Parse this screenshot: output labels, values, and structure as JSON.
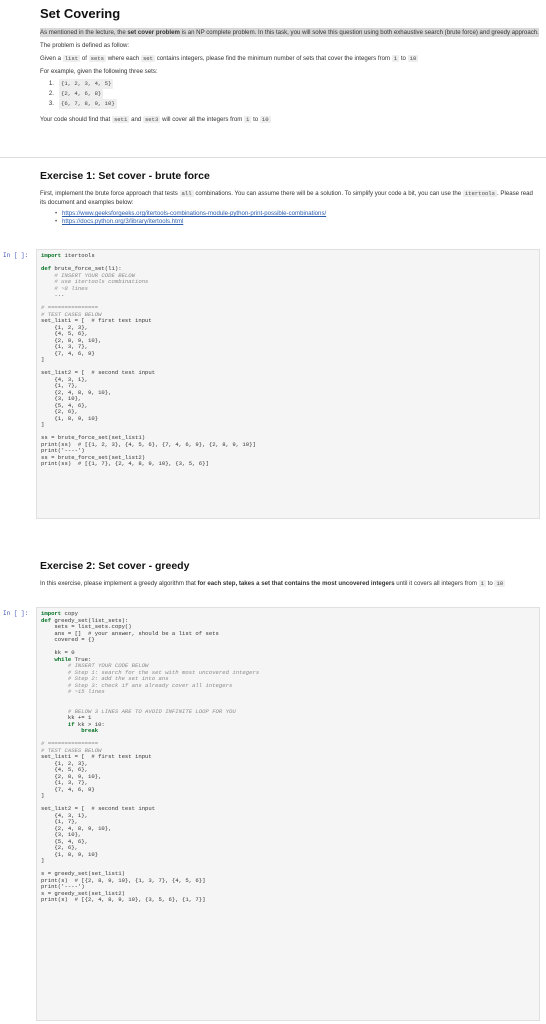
{
  "title": "Set Covering",
  "intro": {
    "p1_pre": "As mentioned in the lecture, the ",
    "p1_bold": "set cover problem",
    "p1_post": " is an NP complete problem. In this task, you will solve this question using both exhaustive search (brute force) and greedy approach.",
    "p2": "The problem is defined as follow:",
    "p3_a": "Given a ",
    "p3_code1": "list",
    "p3_b": " of ",
    "p3_code2": "sets",
    "p3_c": " where each ",
    "p3_code3": "set",
    "p3_d": " contains integers, please find the minimum number of sets that cover the integers from ",
    "p3_code4": "1",
    "p3_e": " to ",
    "p3_code5": "10",
    "p4": "For example, given the following three sets:",
    "list": [
      {
        "num": "1.",
        "code": "{1, 2, 3, 4, 5}"
      },
      {
        "num": "2.",
        "code": "{2, 4, 6, 8}"
      },
      {
        "num": "3.",
        "code": "{6, 7, 8, 9, 10}"
      }
    ],
    "p5_a": "Your code should find that ",
    "p5_code1": "set1",
    "p5_b": " and ",
    "p5_code2": "set3",
    "p5_c": " will cover all the integers from ",
    "p5_code3": "1",
    "p5_d": " to ",
    "p5_code4": "10"
  },
  "ex1": {
    "heading": "Exercise 1: Set cover - brute force",
    "p_a": "First, implement the brute force approach that tests ",
    "p_code1": "all",
    "p_b": " combinations. You can assume there will be a solution. To simplify your code a bit, you can use the ",
    "p_code2": "itertools",
    "p_c": ". Please read its document and examples below:",
    "links": [
      "https://www.geeksforgeeks.org/itertools-combinations-module-python-print-possible-combinations/",
      "https://docs.python.org/3/library/itertools.html"
    ],
    "prompt": "In [ ]:",
    "code": [
      [
        "kw",
        "import",
        " itertools"
      ],
      [
        "",
        "",
        ""
      ],
      [
        "kw",
        "def",
        " brute_force_set(l1):"
      ],
      [
        "cm",
        "",
        "    # INSERT YOUR CODE BELOW"
      ],
      [
        "cm",
        "",
        "    # use itertools combinations"
      ],
      [
        "cm",
        "",
        "    # ~8 lines"
      ],
      [
        "",
        "",
        "    ..."
      ],
      [
        "",
        "",
        ""
      ],
      [
        "cm",
        "",
        "# ==============="
      ],
      [
        "cm",
        "",
        "# TEST CASES BELOW"
      ],
      [
        "",
        "",
        "set_list1 = [  # first test input"
      ],
      [
        "",
        "",
        "    {1, 2, 3},"
      ],
      [
        "",
        "",
        "    {4, 5, 6},"
      ],
      [
        "",
        "",
        "    {2, 8, 9, 10},"
      ],
      [
        "",
        "",
        "    {1, 3, 7},"
      ],
      [
        "",
        "",
        "    {7, 4, 6, 9}"
      ],
      [
        "",
        "",
        "]"
      ],
      [
        "",
        "",
        ""
      ],
      [
        "",
        "",
        "set_list2 = [  # second test input"
      ],
      [
        "",
        "",
        "    {4, 3, 1},"
      ],
      [
        "",
        "",
        "    {1, 7},"
      ],
      [
        "",
        "",
        "    {2, 4, 8, 9, 10},"
      ],
      [
        "",
        "",
        "    {3, 10},"
      ],
      [
        "",
        "",
        "    {5, 4, 6},"
      ],
      [
        "",
        "",
        "    {2, 6},"
      ],
      [
        "",
        "",
        "    {1, 8, 9, 10}"
      ],
      [
        "",
        "",
        "]"
      ],
      [
        "",
        "",
        ""
      ],
      [
        "",
        "",
        "ss = brute_force_set(set_list1)"
      ],
      [
        "",
        "",
        "print(ss)  # [{1, 2, 3}, {4, 5, 6}, {7, 4, 6, 9}, {2, 8, 9, 10}]"
      ],
      [
        "",
        "",
        "print('----')"
      ],
      [
        "",
        "",
        "ss = brute_force_set(set_list2)"
      ],
      [
        "",
        "",
        "print(ss)  # [{1, 7}, {2, 4, 8, 9, 10}, {3, 5, 6}]"
      ]
    ]
  },
  "ex2": {
    "heading": "Exercise 2: Set cover - greedy",
    "p_a": "In this exercise, please implement a greedy algorithm that ",
    "p_bold": "for each step, takes a set that contains the most uncovered integers",
    "p_b": " until it covers all integers from ",
    "p_code1": "1",
    "p_c": " to ",
    "p_code2": "10",
    "prompt": "In [ ]:",
    "code": [
      [
        "kw",
        "import",
        " copy"
      ],
      [
        "kw",
        "def",
        " greedy_set(list_sets):"
      ],
      [
        "",
        "",
        "    sets = list_sets.copy()"
      ],
      [
        "",
        "",
        "    ans = []  # your answer, should be a list of sets"
      ],
      [
        "",
        "",
        "    covered = {}"
      ],
      [
        "",
        "",
        ""
      ],
      [
        "",
        "",
        "    kk = 0"
      ],
      [
        "kw",
        "    while",
        " True:"
      ],
      [
        "cm",
        "",
        "        # INSERT YOUR CODE BELOW"
      ],
      [
        "cm",
        "",
        "        # Step 1: search for the set with most uncovered integers"
      ],
      [
        "cm",
        "",
        "        # Step 2: add the set into ans"
      ],
      [
        "cm",
        "",
        "        # Step 3: check if ans already cover all integers"
      ],
      [
        "cm",
        "",
        "        # ~15 lines"
      ],
      [
        "",
        "",
        ""
      ],
      [
        "",
        "",
        ""
      ],
      [
        "cm",
        "",
        "        # BELOW 3 LINES ARE TO AVOID INFINITE LOOP FOR YOU"
      ],
      [
        "",
        "",
        "        kk += 1"
      ],
      [
        "kw",
        "        if",
        " kk > 10:"
      ],
      [
        "kw",
        "            break",
        ""
      ],
      [
        "",
        "",
        ""
      ],
      [
        "cm",
        "",
        "# ==============="
      ],
      [
        "cm",
        "",
        "# TEST CASES BELOW"
      ],
      [
        "",
        "",
        "set_list1 = [  # first test input"
      ],
      [
        "",
        "",
        "    {1, 2, 3},"
      ],
      [
        "",
        "",
        "    {4, 5, 6},"
      ],
      [
        "",
        "",
        "    {2, 8, 9, 10},"
      ],
      [
        "",
        "",
        "    {1, 3, 7},"
      ],
      [
        "",
        "",
        "    {7, 4, 6, 9}"
      ],
      [
        "",
        "",
        "]"
      ],
      [
        "",
        "",
        ""
      ],
      [
        "",
        "",
        "set_list2 = [  # second test input"
      ],
      [
        "",
        "",
        "    {4, 3, 1},"
      ],
      [
        "",
        "",
        "    {1, 7},"
      ],
      [
        "",
        "",
        "    {2, 4, 8, 9, 10},"
      ],
      [
        "",
        "",
        "    {3, 10},"
      ],
      [
        "",
        "",
        "    {5, 4, 6},"
      ],
      [
        "",
        "",
        "    {2, 6},"
      ],
      [
        "",
        "",
        "    {1, 8, 9, 10}"
      ],
      [
        "",
        "",
        "]"
      ],
      [
        "",
        "",
        ""
      ],
      [
        "",
        "",
        "s = greedy_set(set_list1)"
      ],
      [
        "",
        "",
        "print(s)  # [{2, 8, 9, 10}, {1, 3, 7}, {4, 5, 6}]"
      ],
      [
        "",
        "",
        "print('----')"
      ],
      [
        "",
        "",
        "s = greedy_set(set_list2)"
      ],
      [
        "",
        "",
        "print(s)  # [{2, 4, 8, 9, 10}, {3, 5, 6}, {1, 7}]"
      ]
    ]
  }
}
